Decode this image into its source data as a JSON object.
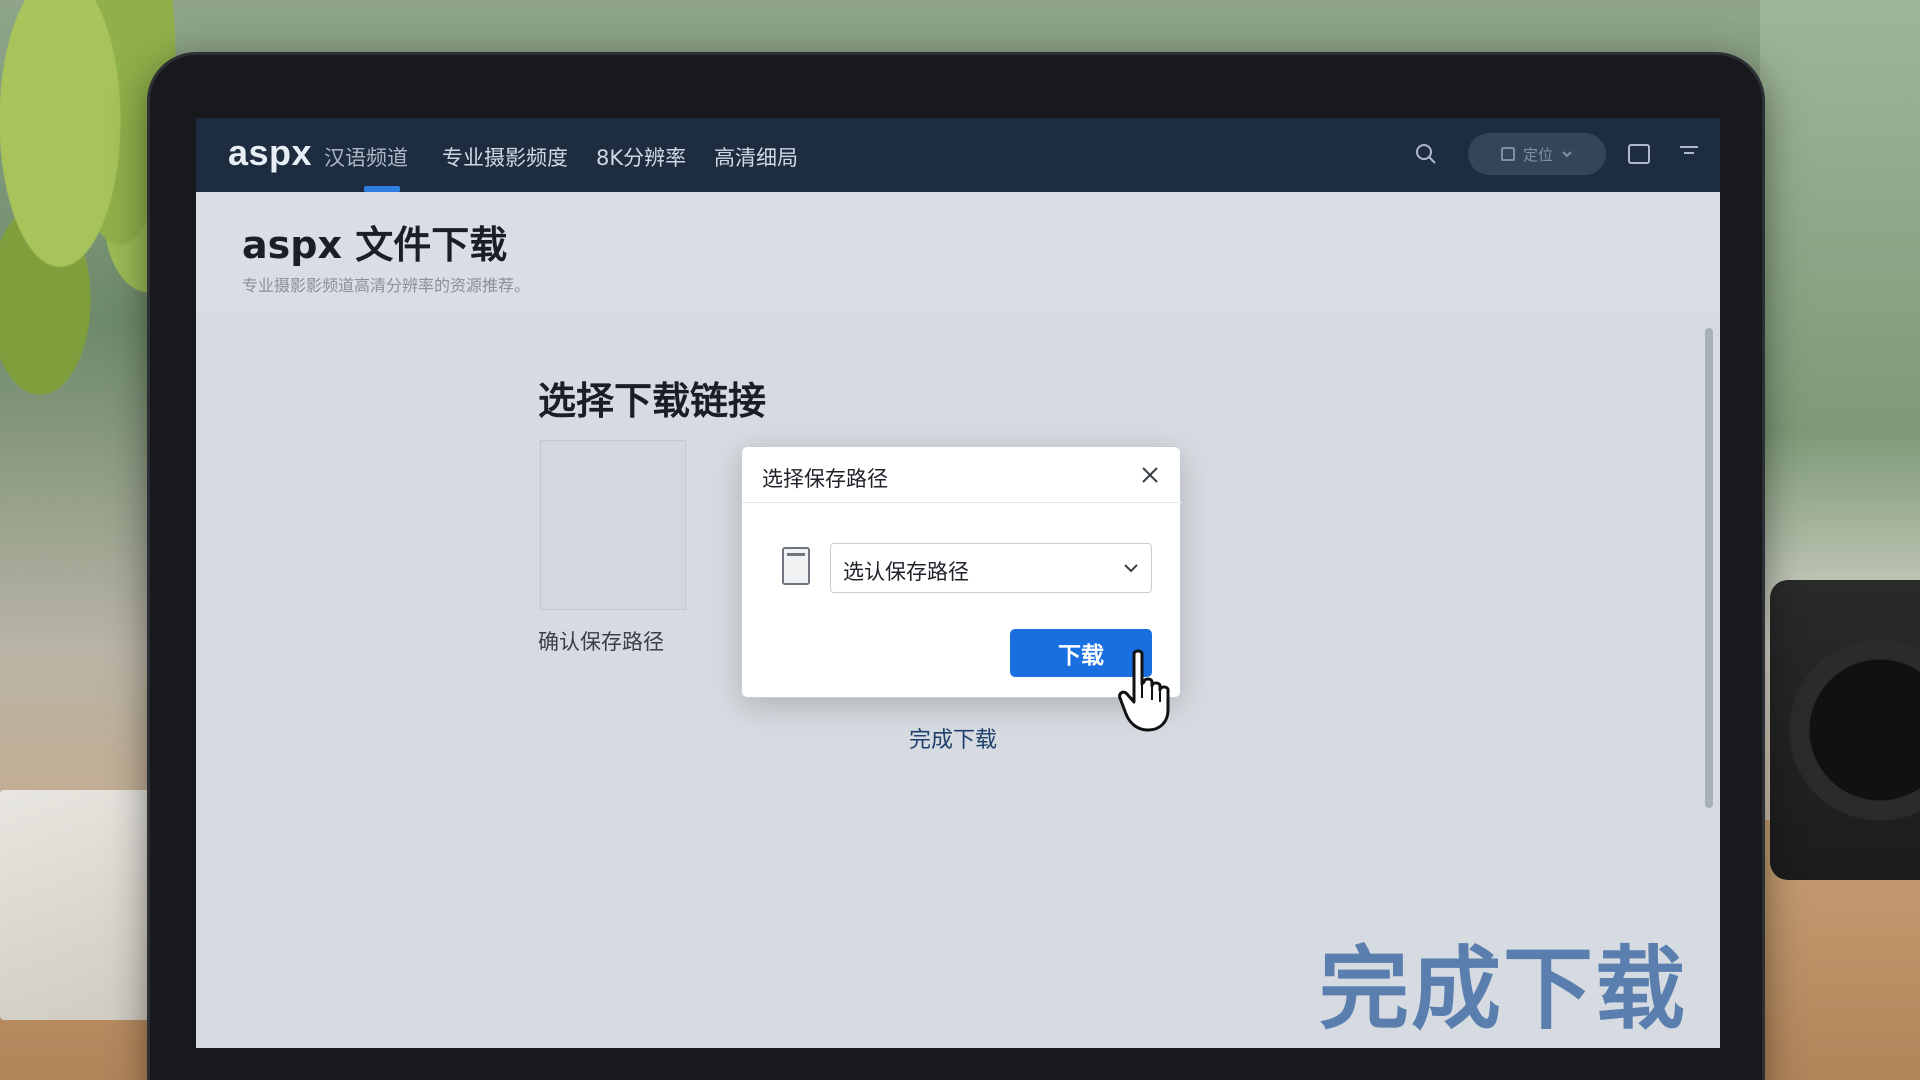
{
  "app": {
    "logo": "aspx",
    "nav": [
      {
        "label": "汉语频道"
      },
      {
        "label": "专业摄影频度"
      },
      {
        "label": "8K分辨率"
      },
      {
        "label": "高清细局"
      }
    ],
    "pill_button": "定位",
    "icons": [
      "search-icon",
      "square-icon",
      "menu-icon"
    ]
  },
  "page": {
    "title": "aspx 文件下载",
    "subtitle": "专业摄影影频道高清分辨率的资源推荐。"
  },
  "content": {
    "title": "选择下载链接",
    "preview_label": "确认保存路径",
    "done_link": "完成下载"
  },
  "dialog": {
    "title": "选择保存路径",
    "select_value": "选认保存路径",
    "download_label": "下载"
  },
  "overlay": {
    "text": "完成下载"
  },
  "colors": {
    "topbar": "#1d2c3f",
    "accent": "#1a6fe0",
    "overlay_text": "#5a7fae"
  }
}
